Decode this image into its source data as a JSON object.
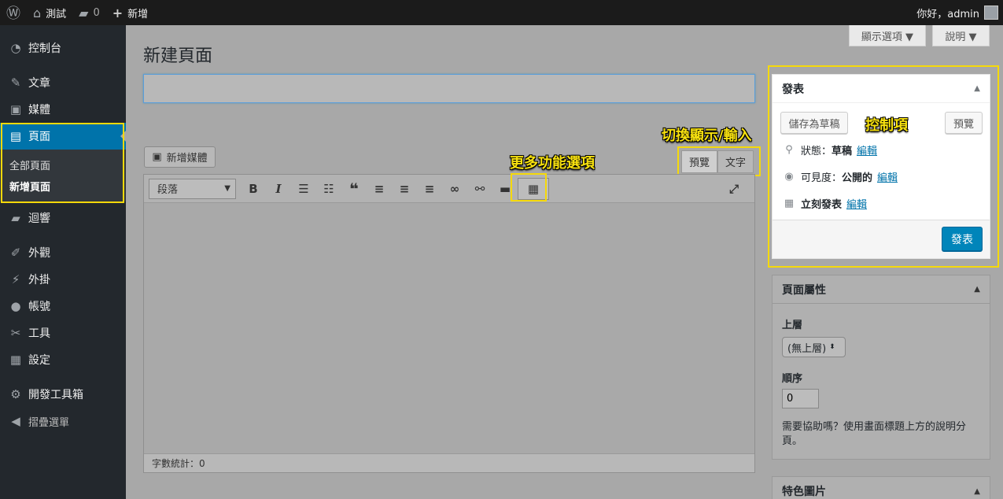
{
  "adminbar": {
    "wp_logo": "wordpress-logo",
    "site_name": "測試",
    "comments_count": "0",
    "new_label": "新增",
    "greeting": "你好，admin"
  },
  "sidebar": {
    "items": [
      {
        "label": "控制台",
        "icon": "dashboard-icon"
      },
      {
        "label": "文章",
        "icon": "pin-icon"
      },
      {
        "label": "媒體",
        "icon": "media-icon"
      },
      {
        "label": "頁面",
        "icon": "page-icon"
      },
      {
        "label": "迴響",
        "icon": "comment-icon"
      },
      {
        "label": "外觀",
        "icon": "brush-icon"
      },
      {
        "label": "外掛",
        "icon": "plugin-icon"
      },
      {
        "label": "帳號",
        "icon": "user-icon"
      },
      {
        "label": "工具",
        "icon": "wrench-icon"
      },
      {
        "label": "設定",
        "icon": "settings-icon"
      },
      {
        "label": "開發工具箱",
        "icon": "gear-icon"
      },
      {
        "label": "摺疊選單",
        "icon": "collapse-icon"
      }
    ],
    "submenu": {
      "all_pages": "全部頁面",
      "add_new": "新增頁面"
    }
  },
  "screen_options": "顯示選項 ▼",
  "help": "說明 ▼",
  "page_title": "新建頁面",
  "title_input": {
    "value": "",
    "placeholder": ""
  },
  "editor": {
    "add_media": "新增媒體",
    "tab_visual": "預覽",
    "tab_text": "文字",
    "format_value": "段落",
    "word_count": "字數統計：0"
  },
  "publish_box": {
    "title": "發表",
    "save_draft": "儲存為草稿",
    "preview": "預覽",
    "status_label": "狀態：",
    "status_value": "草稿",
    "visibility_label": "可見度：",
    "visibility_value": "公開的",
    "schedule_label": "立刻發表",
    "edit_link": "編輯",
    "publish_button": "發表"
  },
  "attributes_box": {
    "title": "頁面屬性",
    "parent_label": "上層",
    "parent_value": "(無上層)",
    "order_label": "順序",
    "order_value": "0",
    "help_text": "需要協助嗎？使用畫面標題上方的說明分頁。"
  },
  "featured_box": {
    "title": "特色圖片"
  },
  "callouts": {
    "switch": "切換顯示/輸入",
    "more": "更多功能選項",
    "control": "控制項"
  },
  "colors": {
    "accent": "#0073aa",
    "highlight": "#f5d90a",
    "primary_button": "#0085ba"
  }
}
